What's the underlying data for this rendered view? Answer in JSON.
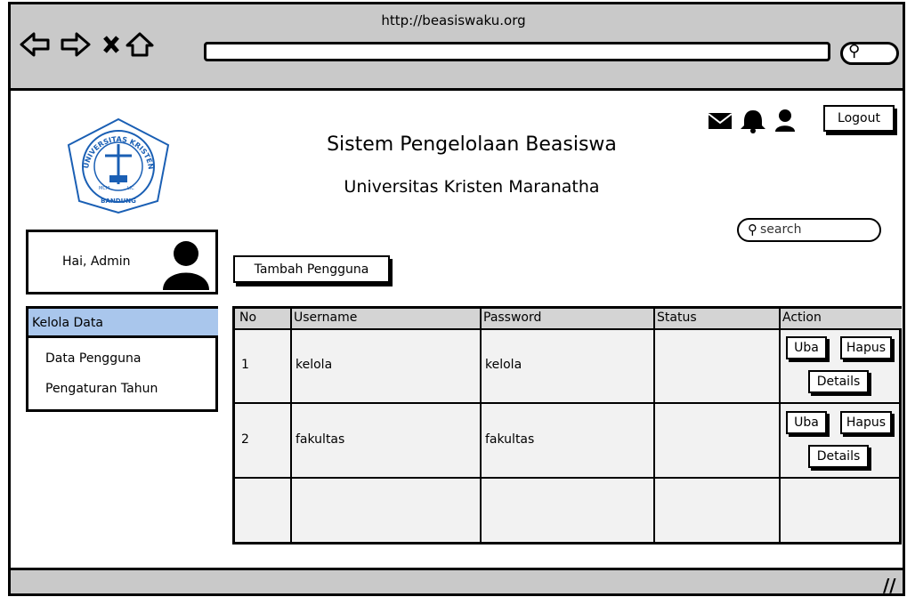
{
  "browser": {
    "url": "http://beasiswaku.org",
    "nav_icons": [
      "back-arrow-icon",
      "forward-arrow-icon",
      "close-icon",
      "home-icon"
    ],
    "search_icon": "search-icon",
    "resize_grip": "//"
  },
  "header": {
    "title": "Sistem Pengelolaan Beasiswa",
    "subtitle": "Universitas Kristen Maranatha",
    "logout_label": "Logout",
    "search_placeholder": "search",
    "top_icons": [
      "mail-icon",
      "bell-icon",
      "user-icon"
    ]
  },
  "logo": {
    "ring_text": "UNIVERSITAS KRISTEN MARANATHA",
    "bottom_text": "BANDUNG",
    "motto_left": "MCM",
    "motto_right": "LIC"
  },
  "user_card": {
    "greeting": "Hai, Admin"
  },
  "sidebar": {
    "heading": "Kelola Data",
    "items": [
      "Data Pengguna",
      "Pengaturan Tahun"
    ]
  },
  "main": {
    "add_button_label": "Tambah Pengguna",
    "table": {
      "columns": [
        "No",
        "Username",
        "Password",
        "Status",
        "Action"
      ],
      "rows": [
        {
          "no": "1",
          "username": "kelola",
          "password": "kelola",
          "status": ""
        },
        {
          "no": "2",
          "username": "fakultas",
          "password": "fakultas",
          "status": ""
        }
      ],
      "actions": {
        "edit": "Uba",
        "delete": "Hapus",
        "details": "Details"
      }
    }
  },
  "colors": {
    "chrome": "#c9c9c9",
    "sidebar_active": "#a9c6ec",
    "table_bg": "#f2f2f2",
    "table_header": "#d4d4d4"
  }
}
